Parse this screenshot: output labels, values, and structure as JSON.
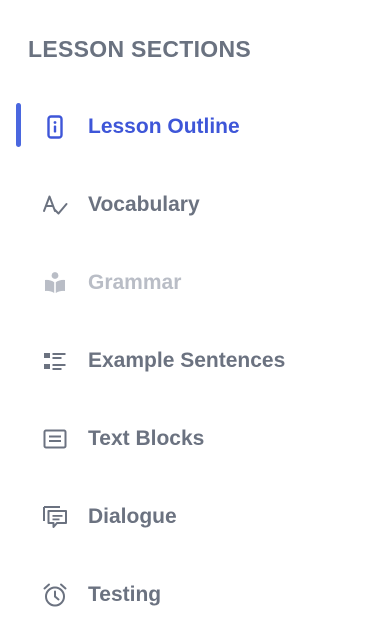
{
  "sidebar": {
    "title": "LESSON SECTIONS",
    "items": [
      {
        "label": "Lesson Outline",
        "icon": "phone-info-icon",
        "active": true
      },
      {
        "label": "Vocabulary",
        "icon": "spellcheck-icon"
      },
      {
        "label": "Grammar",
        "icon": "book-reader-icon",
        "disabled": true
      },
      {
        "label": "Example Sentences",
        "icon": "list-icon"
      },
      {
        "label": "Text Blocks",
        "icon": "text-block-icon"
      },
      {
        "label": "Dialogue",
        "icon": "chat-bubbles-icon"
      },
      {
        "label": "Testing",
        "icon": "alarm-clock-icon"
      }
    ]
  },
  "colors": {
    "active": "#3e56d8",
    "active_bar": "#4a67df",
    "default": "#6b7280",
    "disabled": "#b9bdc6"
  }
}
